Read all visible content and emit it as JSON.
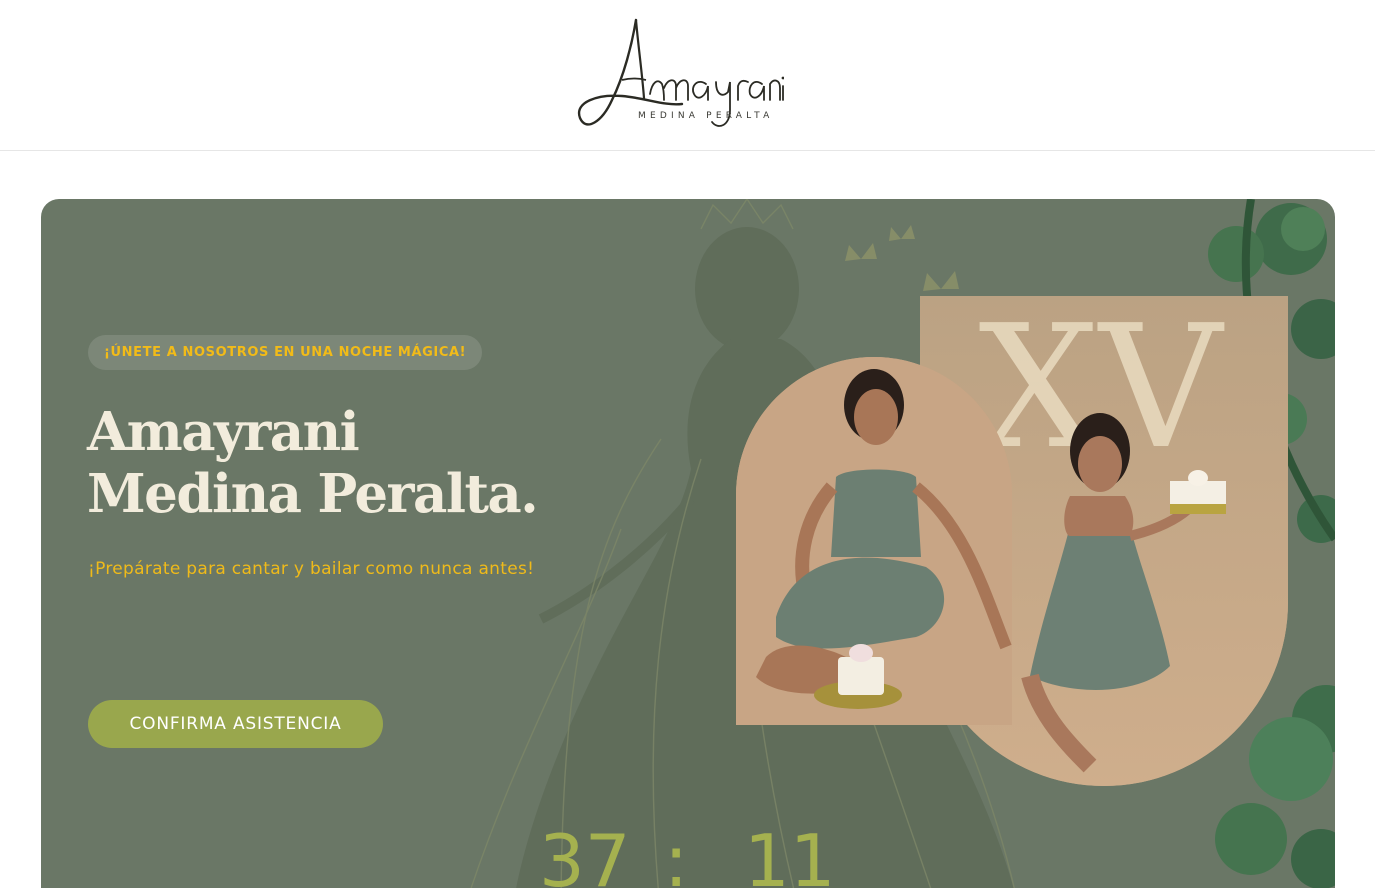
{
  "header": {
    "logo_script": "Amayrani",
    "logo_subtitle": "MEDINA PERALTA"
  },
  "hero": {
    "tag": "¡ÚNETE A NOSOTROS EN UNA NOCHE MÁGICA!",
    "title_line1": "Amayrani",
    "title_line2": "Medina Peralta.",
    "subtitle": "¡Prepárate para cantar y bailar como nunca antes!",
    "cta_label": "CONFIRMA ASISTENCIA",
    "photo_monogram": "XV"
  },
  "countdown": {
    "first": "37",
    "separator": ":",
    "second": "11"
  },
  "colors": {
    "hero_bg": "#6a7766",
    "accent_gold": "#f2bb18",
    "button": "#99a74d",
    "title": "#f2ecdc",
    "countdown": "#a5b14f"
  }
}
